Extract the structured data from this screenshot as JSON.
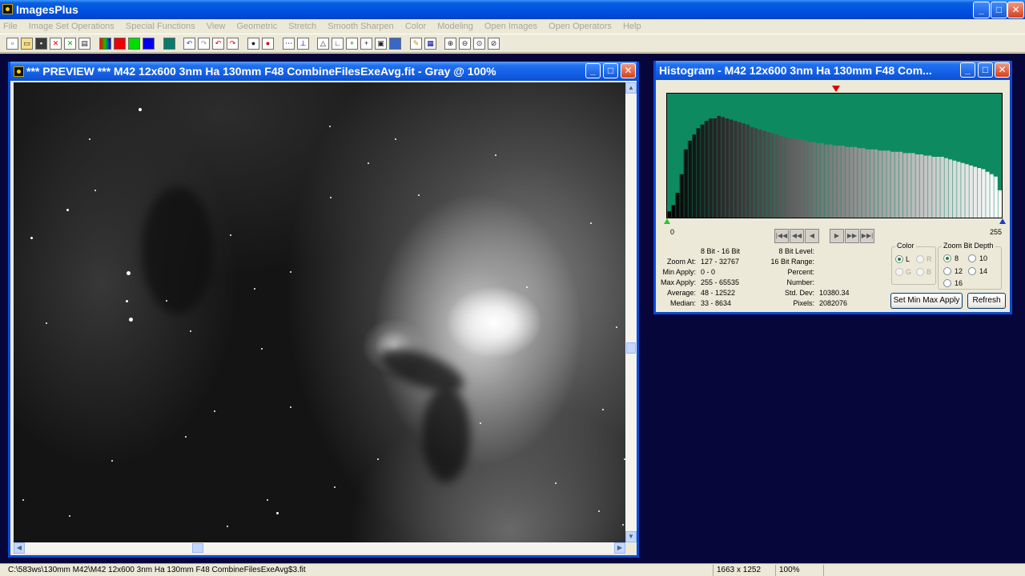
{
  "app": {
    "title": "ImagesPlus"
  },
  "menu": [
    "File",
    "Image Set Operations",
    "Special Functions",
    "View",
    "Geometric",
    "Stretch",
    "Smooth Sharpen",
    "Color",
    "Modeling",
    "Open Images",
    "Open Operators",
    "Help"
  ],
  "toolbar": {
    "icons": [
      "new-icon",
      "open-icon",
      "save-icon",
      "close-file-icon",
      "undo-all-icon",
      "print-icon",
      "rgb-icon",
      "red-channel-icon",
      "green-channel-icon",
      "blue-channel-icon",
      "image-icon",
      "undo-icon",
      "redo-icon",
      "undo-red-icon",
      "redo-red-icon",
      "dot-icon",
      "record-icon",
      "line-icon",
      "graph-icon",
      "triangle-icon",
      "axis-icon",
      "crosshair-icon",
      "grid-cross-icon",
      "box-icon",
      "photo-icon",
      "pencil-icon",
      "table-icon",
      "zoom-in-icon",
      "zoom-out-icon",
      "zoom-fit-icon",
      "zoom-100-icon"
    ]
  },
  "preview_window": {
    "title": "*** PREVIEW *** M42 12x600 3nm Ha 130mm F48 CombineFilesExeAvg.fit - Gray @ 100%"
  },
  "histogram_window": {
    "title": "Histogram - M42 12x600 3nm Ha 130mm F48 Com...",
    "axis_min": "0",
    "axis_max": "255",
    "stats": {
      "depth_header": "8 Bit - 16 Bit",
      "zoom_at_label": "Zoom At:",
      "zoom_at": "127 - 32767",
      "min_apply_label": "Min Apply:",
      "min_apply": "0 - 0",
      "max_apply_label": "Max Apply:",
      "max_apply": "255 - 65535",
      "average_label": "Average:",
      "average": "48 - 12522",
      "median_label": "Median:",
      "median": "33 - 8634",
      "bit8_level_label": "8 Bit Level:",
      "bit16_range_label": "16 Bit Range:",
      "percent_label": "Percent:",
      "number_label": "Number:",
      "std_dev_label": "Std. Dev:",
      "std_dev": "10380.34",
      "pixels_label": "Pixels:",
      "pixels": "2082076"
    },
    "color_group": {
      "title": "Color",
      "options": [
        "L",
        "R",
        "G",
        "B"
      ],
      "selected": "L"
    },
    "zoom_group": {
      "title": "Zoom Bit Depth",
      "options": [
        "8",
        "10",
        "12",
        "14",
        "16"
      ],
      "selected": "8"
    },
    "buttons": {
      "set_min_max": "Set Min Max Apply",
      "refresh": "Refresh"
    },
    "colors": {
      "plot_background": "#0e8a60"
    }
  },
  "chart_data": {
    "type": "bar",
    "xlim": [
      0,
      255
    ],
    "note_bins": "relative counts per 8-bit level, sampled",
    "values": [
      0.05,
      0.1,
      0.2,
      0.35,
      0.55,
      0.62,
      0.67,
      0.72,
      0.75,
      0.78,
      0.8,
      0.8,
      0.82,
      0.81,
      0.8,
      0.79,
      0.78,
      0.77,
      0.76,
      0.75,
      0.73,
      0.72,
      0.71,
      0.7,
      0.69,
      0.68,
      0.67,
      0.66,
      0.65,
      0.64,
      0.64,
      0.63,
      0.63,
      0.62,
      0.61,
      0.61,
      0.6,
      0.6,
      0.59,
      0.59,
      0.58,
      0.58,
      0.58,
      0.57,
      0.57,
      0.57,
      0.56,
      0.56,
      0.55,
      0.55,
      0.55,
      0.54,
      0.54,
      0.54,
      0.53,
      0.53,
      0.53,
      0.52,
      0.52,
      0.52,
      0.51,
      0.51,
      0.5,
      0.5,
      0.49,
      0.49,
      0.49,
      0.48,
      0.47,
      0.46,
      0.45,
      0.44,
      0.43,
      0.42,
      0.41,
      0.4,
      0.39,
      0.37,
      0.35,
      0.33,
      0.22
    ]
  },
  "status": {
    "path": "C:\\583ws\\130mm M42\\M42 12x600 3nm Ha 130mm F48 CombineFilesExeAvg$3.fit",
    "dimensions": "1663 x 1252",
    "zoom": "100%"
  }
}
